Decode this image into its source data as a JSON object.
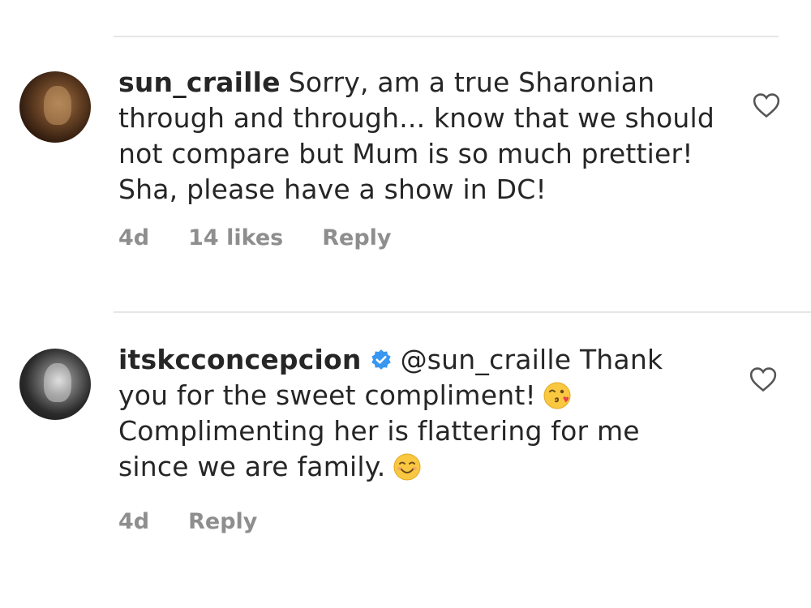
{
  "comments": [
    {
      "username": "sun_craille",
      "verified": false,
      "text": "Sorry, am a true Sharonian through and through... know that we should not compare but Mum is so much prettier! Sha, please have a show in DC!",
      "time": "4d",
      "likes": "14 likes",
      "reply_label": "Reply"
    },
    {
      "username": "itskcconcepcion",
      "verified": true,
      "mention": "@sun_craille",
      "text_part1": "Thank you for the sweet compliment!",
      "text_part2": "Complimenting her is flattering for me since we are family.",
      "time": "4d",
      "reply_label": "Reply"
    }
  ],
  "icons": {
    "like": "heart-outline-icon",
    "verified": "verified-badge-icon",
    "emoji_1": "kissing-wink-emoji",
    "emoji_2": "smiling-emoji"
  },
  "colors": {
    "meta": "#8e8e8e",
    "verified": "#3897f0",
    "emoji": "#f9c840"
  }
}
